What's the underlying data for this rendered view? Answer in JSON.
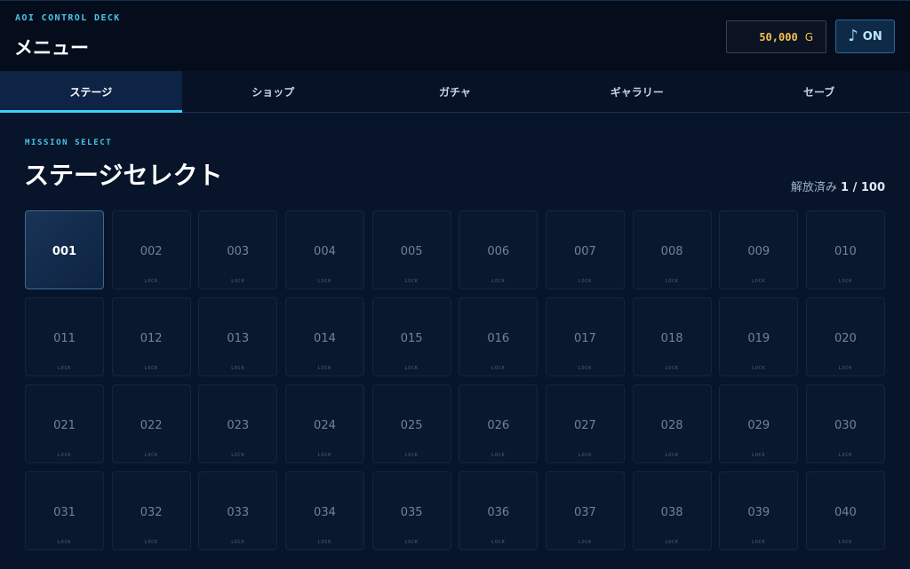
{
  "header": {
    "brand": "AOI CONTROL DECK",
    "title": "メニュー",
    "gold_value": "50,000",
    "gold_unit": "G",
    "music_icon": "♪",
    "music_label": "ON"
  },
  "tabs": [
    {
      "label": "ステージ",
      "active": true
    },
    {
      "label": "ショップ",
      "active": false
    },
    {
      "label": "ガチャ",
      "active": false
    },
    {
      "label": "ギャラリー",
      "active": false
    },
    {
      "label": "セーブ",
      "active": false
    }
  ],
  "section": {
    "subtitle": "MISSION SELECT",
    "title": "ステージセレクト",
    "progress_label": "解放済み",
    "progress_value": "1 / 100"
  },
  "stages": {
    "lock_label": "LOCK",
    "items": [
      {
        "num": "001",
        "locked": false
      },
      {
        "num": "002",
        "locked": true
      },
      {
        "num": "003",
        "locked": true
      },
      {
        "num": "004",
        "locked": true
      },
      {
        "num": "005",
        "locked": true
      },
      {
        "num": "006",
        "locked": true
      },
      {
        "num": "007",
        "locked": true
      },
      {
        "num": "008",
        "locked": true
      },
      {
        "num": "009",
        "locked": true
      },
      {
        "num": "010",
        "locked": true
      },
      {
        "num": "011",
        "locked": true
      },
      {
        "num": "012",
        "locked": true
      },
      {
        "num": "013",
        "locked": true
      },
      {
        "num": "014",
        "locked": true
      },
      {
        "num": "015",
        "locked": true
      },
      {
        "num": "016",
        "locked": true
      },
      {
        "num": "017",
        "locked": true
      },
      {
        "num": "018",
        "locked": true
      },
      {
        "num": "019",
        "locked": true
      },
      {
        "num": "020",
        "locked": true
      },
      {
        "num": "021",
        "locked": true
      },
      {
        "num": "022",
        "locked": true
      },
      {
        "num": "023",
        "locked": true
      },
      {
        "num": "024",
        "locked": true
      },
      {
        "num": "025",
        "locked": true
      },
      {
        "num": "026",
        "locked": true
      },
      {
        "num": "027",
        "locked": true
      },
      {
        "num": "028",
        "locked": true
      },
      {
        "num": "029",
        "locked": true
      },
      {
        "num": "030",
        "locked": true
      },
      {
        "num": "031",
        "locked": true
      },
      {
        "num": "032",
        "locked": true
      },
      {
        "num": "033",
        "locked": true
      },
      {
        "num": "034",
        "locked": true
      },
      {
        "num": "035",
        "locked": true
      },
      {
        "num": "036",
        "locked": true
      },
      {
        "num": "037",
        "locked": true
      },
      {
        "num": "038",
        "locked": true
      },
      {
        "num": "039",
        "locked": true
      },
      {
        "num": "040",
        "locked": true
      }
    ]
  },
  "colors": {
    "accent": "#3fd2f5",
    "gold": "#f2c14e",
    "background": "#071429"
  }
}
